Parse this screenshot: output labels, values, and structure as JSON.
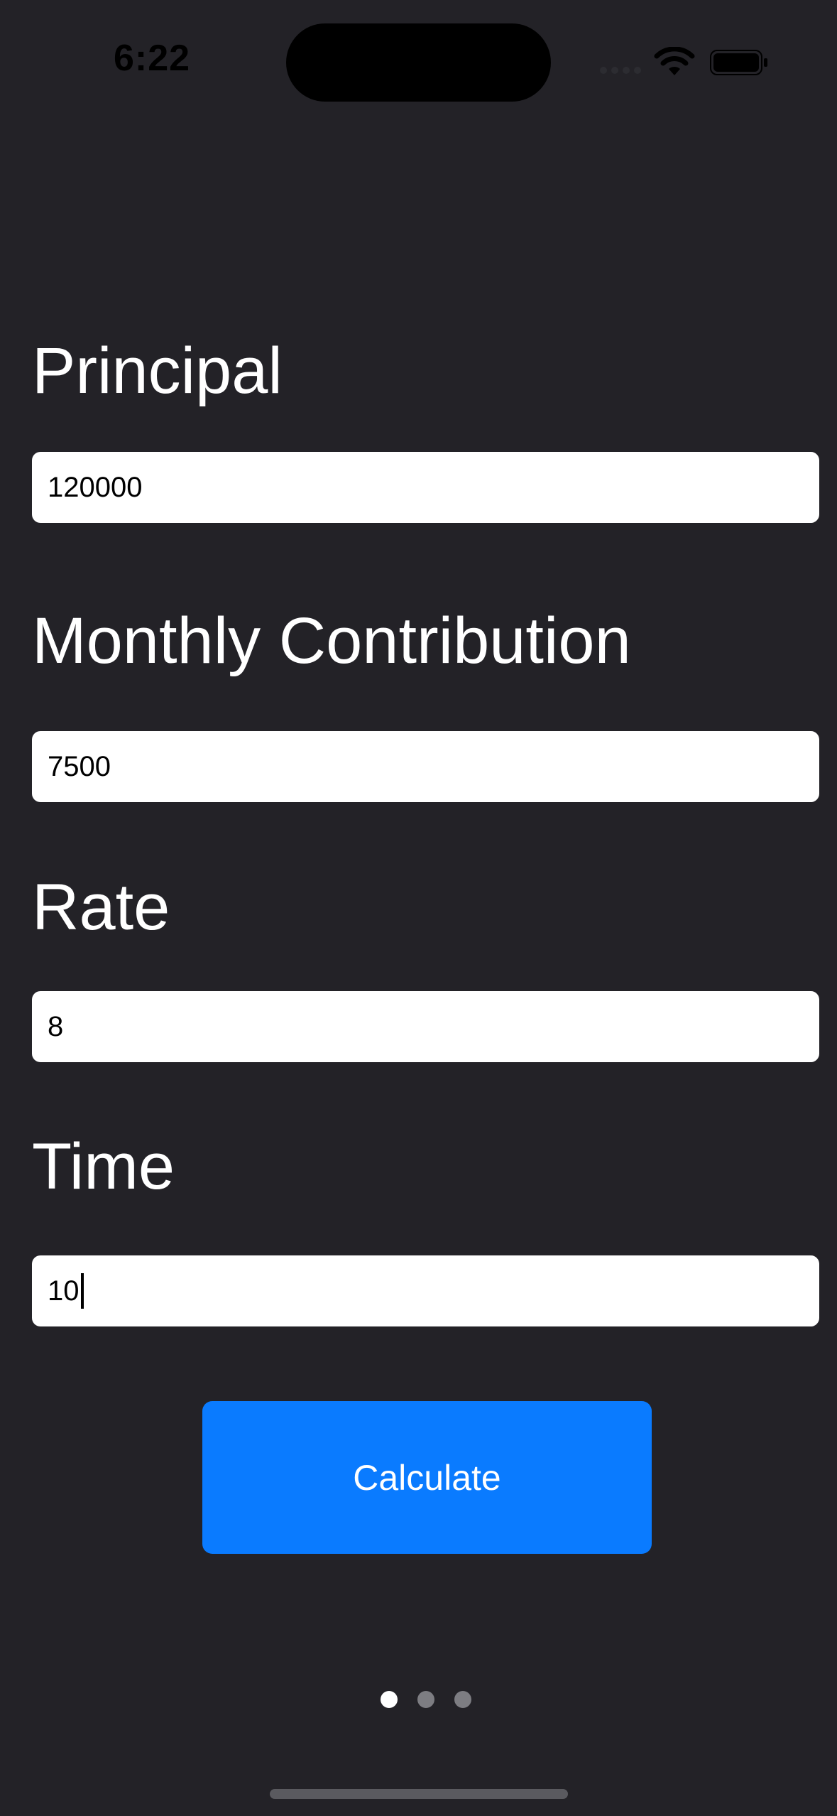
{
  "status_bar": {
    "time": "6:22"
  },
  "form": {
    "fields": [
      {
        "label": "Principal",
        "value": "120000"
      },
      {
        "label": "Monthly Contribution",
        "value": "7500"
      },
      {
        "label": "Rate",
        "value": "8"
      },
      {
        "label": "Time",
        "value": "10"
      }
    ],
    "calculate_label": "Calculate"
  },
  "pager": {
    "count": 3,
    "active_index": 0
  },
  "colors": {
    "background": "#232227",
    "accent": "#0a7bff",
    "field_background": "#ffffff"
  },
  "icons": [
    "wifi-icon",
    "battery-icon",
    "signal-icon"
  ]
}
